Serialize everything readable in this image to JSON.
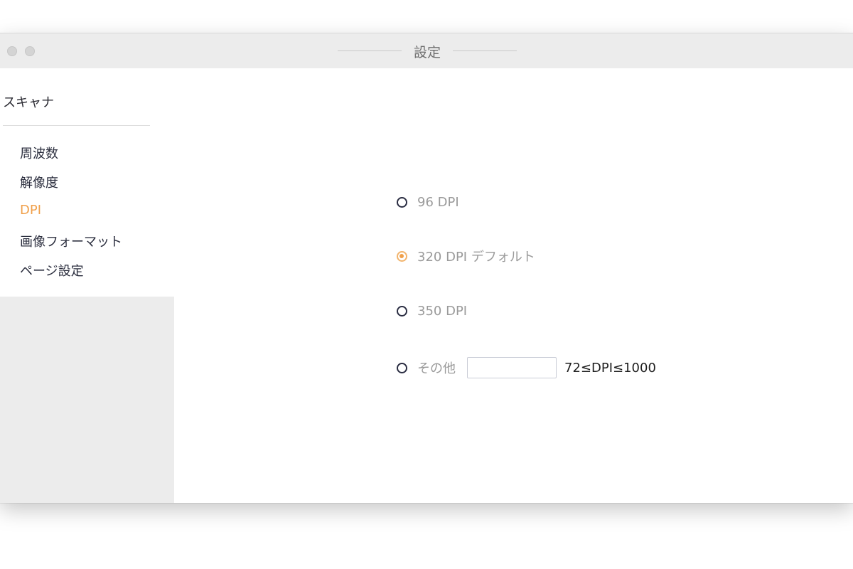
{
  "window": {
    "title": "設定"
  },
  "sidebar": {
    "heading": "スキャナ",
    "items": [
      {
        "label": "周波数",
        "active": false
      },
      {
        "label": "解像度",
        "active": false
      },
      {
        "label": "DPI",
        "active": true
      },
      {
        "label": "画像フォーマット",
        "active": false
      },
      {
        "label": "ページ設定",
        "active": false
      }
    ]
  },
  "dpi_options": [
    {
      "label": "96 DPI",
      "checked": false
    },
    {
      "label": "320 DPI デフォルト",
      "checked": true
    },
    {
      "label": "350 DPI",
      "checked": false
    },
    {
      "label": "その他",
      "checked": false
    }
  ],
  "other_input": {
    "value": "",
    "hint": "72≤DPI≤1000"
  },
  "colors": {
    "accent": "#f0a04b",
    "radio_border": "#2a2d42",
    "sidebar_bg": "#ececec",
    "titlebar_bg": "#ececec"
  }
}
